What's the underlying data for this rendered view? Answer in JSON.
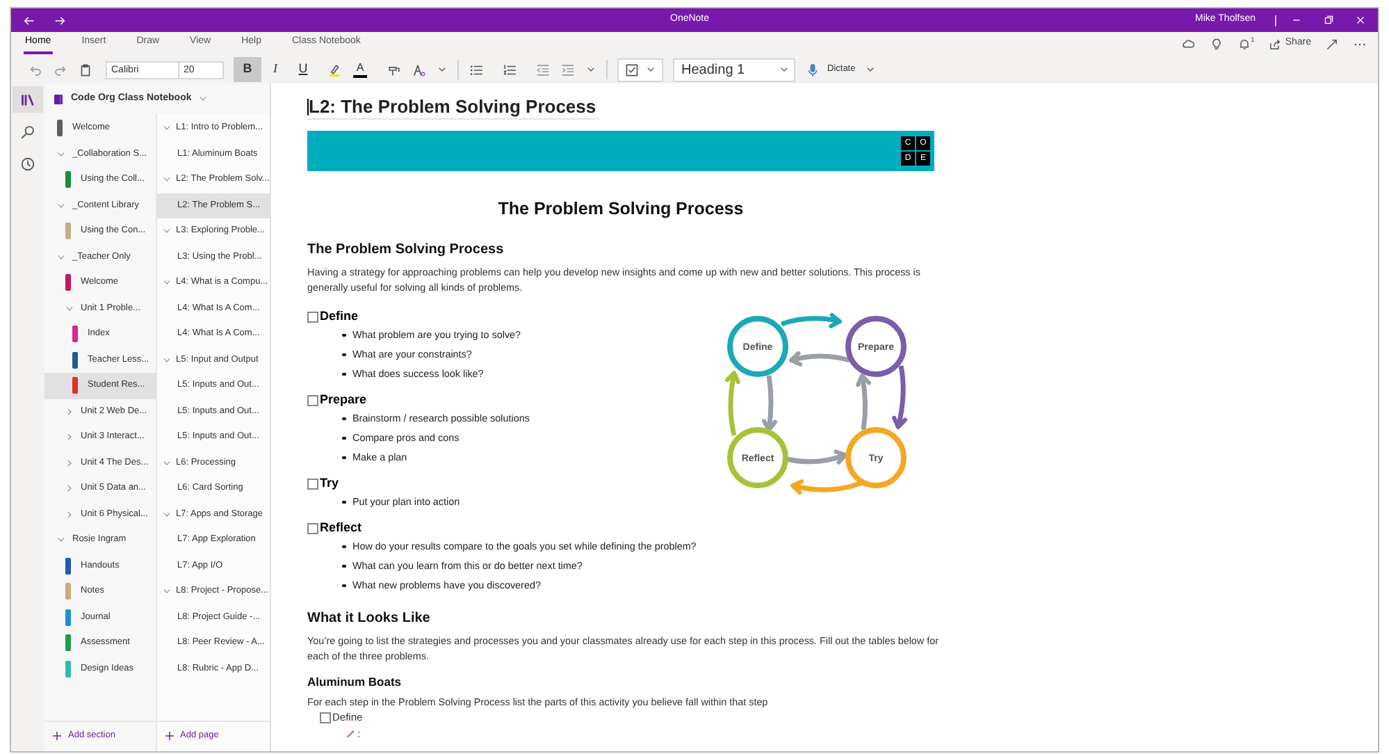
{
  "title_bar": {
    "title": "OneNote",
    "user": "Mike Tholfsen"
  },
  "ribbon_tabs": [
    {
      "label": "Home",
      "selected": true
    },
    {
      "label": "Insert",
      "selected": false
    },
    {
      "label": "Draw",
      "selected": false
    },
    {
      "label": "View",
      "selected": false
    },
    {
      "label": "Help",
      "selected": false
    },
    {
      "label": "Class Notebook",
      "selected": false
    }
  ],
  "toolbar": {
    "font": "Calibri",
    "size": "20",
    "format_buttons": [
      {
        "kind": "bold",
        "label": "B",
        "selected": true
      },
      {
        "kind": "italic",
        "label": "I",
        "selected": false
      },
      {
        "kind": "underline",
        "label": "U",
        "selected": false
      }
    ],
    "font_color": "A",
    "style": "Heading 1",
    "dictate": "Dictate"
  },
  "actions": {
    "notification_count": "1",
    "share": "Share"
  },
  "rail": [
    {
      "kind": "notebooks",
      "selected": true
    },
    {
      "kind": "search",
      "selected": false
    },
    {
      "kind": "recent",
      "selected": false
    }
  ],
  "notebook": {
    "name": "Code Org Class Notebook",
    "sections": [
      {
        "kind": "section",
        "label": "Welcome",
        "color": "#5f5f5f",
        "selected": false
      },
      {
        "kind": "group",
        "label": "_Collaboration S...",
        "expanded": true,
        "children": [
          {
            "kind": "section",
            "label": "Using the Coll...",
            "color": "#1f8a3f",
            "selected": false
          }
        ]
      },
      {
        "kind": "group",
        "label": "_Content Library",
        "expanded": true,
        "children": [
          {
            "kind": "section",
            "label": "Using the Con...",
            "color": "#c9ab85",
            "selected": false
          }
        ]
      },
      {
        "kind": "group",
        "label": "_Teacher Only",
        "expanded": true,
        "children": [
          {
            "kind": "section",
            "label": "Welcome",
            "color": "#c2185b",
            "selected": false
          },
          {
            "kind": "group",
            "label": "Unit 1 Proble...",
            "expanded": true,
            "children": [
              {
                "kind": "section",
                "label": "Index",
                "color": "#d6298f",
                "selected": false
              },
              {
                "kind": "section",
                "label": "Teacher Less...",
                "color": "#1d5d8c",
                "selected": false
              },
              {
                "kind": "section",
                "label": "Student Res...",
                "color": "#e0302d",
                "selected": true
              }
            ]
          },
          {
            "kind": "group",
            "label": "Unit 2 Web De...",
            "expanded": false
          },
          {
            "kind": "group",
            "label": "Unit 3 Interact...",
            "expanded": false
          },
          {
            "kind": "group",
            "label": "Unit 4 The Des...",
            "expanded": false
          },
          {
            "kind": "group",
            "label": "Unit 5 Data an...",
            "expanded": false
          },
          {
            "kind": "group",
            "label": "Unit 6 Physical...",
            "expanded": false
          }
        ]
      },
      {
        "kind": "group",
        "label": "Rosie Ingram",
        "expanded": true,
        "children": [
          {
            "kind": "section",
            "label": "Handouts",
            "color": "#1f5ba6",
            "selected": false
          },
          {
            "kind": "section",
            "label": "Notes",
            "color": "#c9ab85",
            "selected": false
          },
          {
            "kind": "section",
            "label": "Journal",
            "color": "#1e8fc9",
            "selected": false
          },
          {
            "kind": "section",
            "label": "Assessment",
            "color": "#1f9b52",
            "selected": false
          },
          {
            "kind": "section",
            "label": "Design Ideas",
            "color": "#2dbbab",
            "selected": false
          }
        ]
      }
    ],
    "pages": [
      {
        "label": "L1: Intro to Problem...",
        "selected": false,
        "expanded": true,
        "children": [
          {
            "label": "L1: Aluminum Boats",
            "selected": false
          }
        ]
      },
      {
        "label": "L2: The Problem Solv...",
        "selected": false,
        "expanded": true,
        "children": [
          {
            "label": "L2: The Problem S...",
            "selected": true
          }
        ]
      },
      {
        "label": "L3: Exploring Proble...",
        "selected": false,
        "expanded": true,
        "children": [
          {
            "label": "L3: Using the Probl...",
            "selected": false
          }
        ]
      },
      {
        "label": "L4: What is a Compu...",
        "selected": false,
        "expanded": true,
        "children": [
          {
            "label": "L4: What Is A Com...",
            "selected": false
          },
          {
            "label": "L4: What Is A Com...",
            "selected": false
          }
        ]
      },
      {
        "label": "L5: Input and Output",
        "selected": false,
        "expanded": true,
        "children": [
          {
            "label": "L5: Inputs and Out...",
            "selected": false
          },
          {
            "label": "L5: Inputs and Out...",
            "selected": false
          },
          {
            "label": "L5: Inputs and Out...",
            "selected": false
          }
        ]
      },
      {
        "label": "L6: Processing",
        "selected": false,
        "expanded": true,
        "children": [
          {
            "label": "L6: Card Sorting",
            "selected": false
          }
        ]
      },
      {
        "label": "L7: Apps and Storage",
        "selected": false,
        "expanded": true,
        "children": [
          {
            "label": "L7: App Exploration",
            "selected": false
          },
          {
            "label": "L7: App I/O",
            "selected": false
          }
        ]
      },
      {
        "label": "L8: Project - Propose...",
        "selected": false,
        "expanded": true,
        "children": [
          {
            "label": "L8: Project Guide -...",
            "selected": false
          },
          {
            "label": "L8: Peer Review - A...",
            "selected": false
          },
          {
            "label": "L8: Rubric - App D...",
            "selected": false
          }
        ]
      }
    ],
    "add_section": "Add section",
    "add_page": "Add page"
  },
  "page": {
    "title": "L2: The Problem Solving Process",
    "logo": [
      "C",
      "O",
      "D",
      "E"
    ],
    "heading": "The Problem Solving Process",
    "subheading": "The Problem Solving Process",
    "intro": "Having a strategy for approaching problems can help you develop new insights and come up with new and better solutions. This process is generally useful for solving all kinds of problems.",
    "steps": [
      {
        "label": "Define",
        "checked": false,
        "bullets": [
          "What problem are you trying to solve?",
          "What are your constraints?",
          "What does success look like?"
        ]
      },
      {
        "label": "Prepare",
        "checked": false,
        "bullets": [
          "Brainstorm / research possible solutions",
          "Compare pros and cons",
          "Make a plan"
        ]
      },
      {
        "label": "Try",
        "checked": false,
        "bullets": [
          "Put your plan into action"
        ]
      },
      {
        "label": "Reflect",
        "checked": false,
        "bullets": [
          "How do your results compare to the goals you set while defining the problem?",
          "What can you learn from this or do better next time?",
          "What new problems have you discovered?"
        ]
      }
    ],
    "diagram": {
      "nodes": [
        {
          "label": "Define",
          "color": "#1ba9b6"
        },
        {
          "label": "Prepare",
          "color": "#7a5ea8"
        },
        {
          "label": "Reflect",
          "color": "#a6c23a"
        },
        {
          "label": "Try",
          "color": "#f5a623"
        }
      ]
    },
    "section_heading": "What it Looks Like",
    "section_text": "You’re going to list the strategies and processes you and your classmates already use for each step in this process. Fill out the tables below for each of the three problems.",
    "activity_heading": "Aluminum Boats",
    "activity_text": "For each step in the Problem Solving Process list the parts of this activity you believe fall within that step",
    "activity_steps": [
      {
        "label": "Define",
        "checked": false
      }
    ],
    "answer_prompt": ":"
  }
}
